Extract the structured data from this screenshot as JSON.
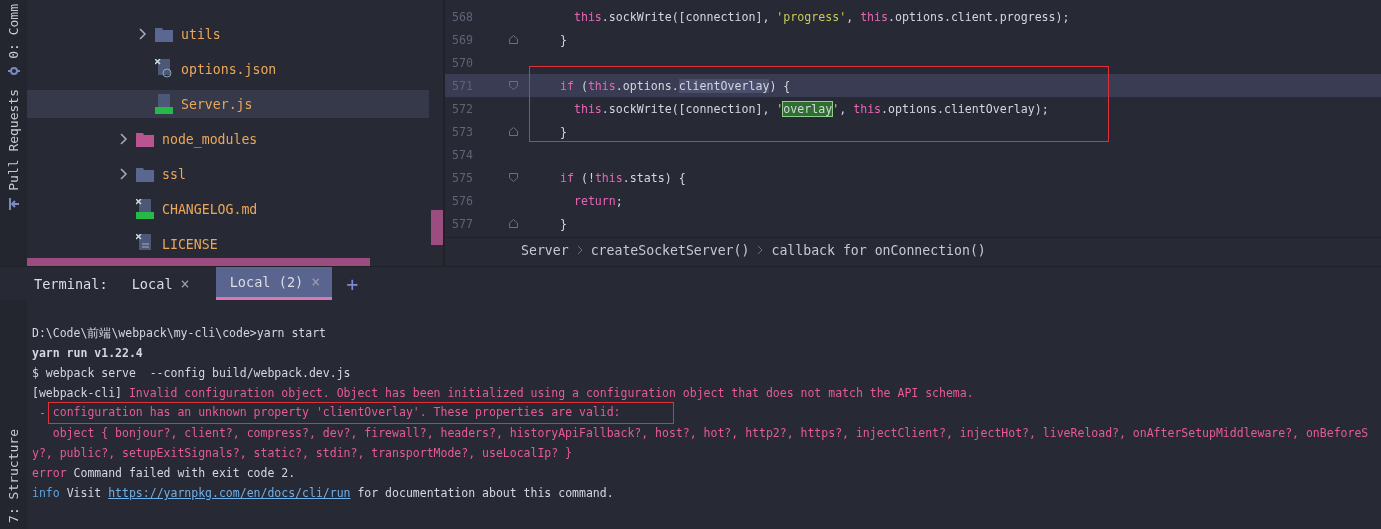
{
  "tool_strip": {
    "top_label": "0: Comm",
    "middle_label": "Pull Requests",
    "bottom_label": "7: Structure"
  },
  "project_tree": {
    "items": [
      {
        "children": [
          {
            "name": "utils",
            "kind": "folder",
            "selected": false
          },
          {
            "name": "options.json",
            "kind": "json",
            "selected": false
          },
          {
            "name": "Server.js",
            "kind": "js",
            "selected": true
          }
        ]
      },
      {
        "name": "node_modules",
        "kind": "excluded-folder",
        "selected": false
      },
      {
        "name": "ssl",
        "kind": "folder",
        "selected": false
      },
      {
        "name": "CHANGELOG.md",
        "kind": "md",
        "selected": false
      },
      {
        "name": "LICENSE",
        "kind": "text",
        "selected": false
      }
    ]
  },
  "editor": {
    "lines": [
      {
        "number": "568",
        "current": false,
        "fold_start": false,
        "fold_end": false,
        "tokens": [
          {
            "t": "    this",
            "kind": "keyword"
          },
          {
            "t": ".sockWrite([connection], ",
            "kind": "plain"
          },
          {
            "t": "'progress'",
            "kind": "string"
          },
          {
            "t": ", ",
            "kind": "plain"
          },
          {
            "t": "this",
            "kind": "keyword"
          },
          {
            "t": ".options.client.progress);",
            "kind": "plain"
          }
        ]
      },
      {
        "number": "569",
        "current": false,
        "fold_start": false,
        "fold_end": true,
        "tokens": [
          {
            "t": "  }",
            "kind": "plain"
          }
        ]
      },
      {
        "number": "570",
        "current": false,
        "fold_start": false,
        "fold_end": false
      },
      {
        "number": "571",
        "current": true,
        "fold_start": true,
        "fold_end": false,
        "tokens": [
          {
            "t": "  if",
            "kind": "keyword"
          },
          {
            "t": " (",
            "kind": "plain"
          },
          {
            "t": "this",
            "kind": "keyword"
          },
          {
            "t": ".options.",
            "kind": "plain"
          },
          {
            "t": "clientOverlay",
            "kind": "selection"
          },
          {
            "t": ") {",
            "kind": "plain"
          }
        ]
      },
      {
        "number": "572",
        "current": false,
        "fold_start": false,
        "fold_end": false,
        "tokens": [
          {
            "t": "    this",
            "kind": "keyword"
          },
          {
            "t": ".sockWrite([connection], ",
            "kind": "plain"
          },
          {
            "t": "'",
            "kind": "string"
          },
          {
            "t": "overlay",
            "kind": "match"
          },
          {
            "t": "'",
            "kind": "string"
          },
          {
            "t": ", ",
            "kind": "plain"
          },
          {
            "t": "this",
            "kind": "keyword"
          },
          {
            "t": ".options.clientOverlay);",
            "kind": "plain"
          }
        ]
      },
      {
        "number": "573",
        "current": false,
        "fold_start": false,
        "fold_end": true,
        "tokens": [
          {
            "t": "  }",
            "kind": "plain"
          }
        ]
      },
      {
        "number": "574",
        "current": false,
        "fold_start": false,
        "fold_end": false
      },
      {
        "number": "575",
        "current": false,
        "fold_start": true,
        "fold_end": false,
        "tokens": [
          {
            "t": "  if",
            "kind": "keyword"
          },
          {
            "t": " (!",
            "kind": "plain"
          },
          {
            "t": "this",
            "kind": "keyword"
          },
          {
            "t": ".stats) {",
            "kind": "plain"
          }
        ]
      },
      {
        "number": "576",
        "current": false,
        "fold_start": false,
        "fold_end": false,
        "tokens": [
          {
            "t": "    return",
            "kind": "keyword"
          },
          {
            "t": ";",
            "kind": "plain"
          }
        ]
      },
      {
        "number": "577",
        "current": false,
        "fold_start": false,
        "fold_end": true,
        "tokens": [
          {
            "t": "  }",
            "kind": "plain"
          }
        ]
      }
    ],
    "breadcrumbs": [
      "Server",
      "createSocketServer()",
      "callback for onConnection()"
    ]
  },
  "terminal": {
    "label": "Terminal:",
    "tabs": [
      {
        "label": "Local",
        "selected": false,
        "close": "×"
      },
      {
        "label": "Local (2)",
        "selected": true,
        "close": "×"
      }
    ],
    "add": "+",
    "lines": [
      [
        {
          "t": "D:\\Code\\前端\\webpack\\my-cli\\code>yarn start",
          "kind": "plain"
        }
      ],
      [
        {
          "t": "yarn run v1.22.4",
          "kind": "bold"
        }
      ],
      [
        {
          "t": "$ webpack serve  --config build/webpack.dev.js",
          "kind": "plain"
        }
      ],
      [
        {
          "t": "[webpack-cli] ",
          "kind": "plain"
        },
        {
          "t": "Invalid configuration object. Object has been initialized using a configuration object that does not match the API schema.",
          "kind": "error"
        }
      ],
      [
        {
          "t": " - ",
          "kind": "error",
          "annotated": false
        },
        {
          "t": "configuration has an unknown property 'clientOverlay'. These properties are valid:",
          "kind": "error",
          "annotated": true
        }
      ],
      [
        {
          "t": "   object { bonjour?, client?, compress?, dev?, firewall?, headers?, historyApiFallback?, host?, hot?, http2?, https?, injectClient?, injectHot?, liveReload?, onAfterSetupMiddleware?, onBeforeS",
          "kind": "error"
        }
      ],
      [
        {
          "t": "y?, public?, setupExitSignals?, static?, stdin?, transportMode?, useLocalIp? }",
          "kind": "error"
        }
      ],
      [
        {
          "t": "error",
          "kind": "error-label"
        },
        {
          "t": " Command failed with exit code 2.",
          "kind": "plain"
        }
      ],
      [
        {
          "t": "info",
          "kind": "info-label"
        },
        {
          "t": " Visit ",
          "kind": "plain"
        },
        {
          "t": "https://yarnpkg.com/en/docs/cli/run",
          "kind": "link"
        },
        {
          "t": " for documentation about this command.",
          "kind": "plain"
        }
      ]
    ]
  }
}
